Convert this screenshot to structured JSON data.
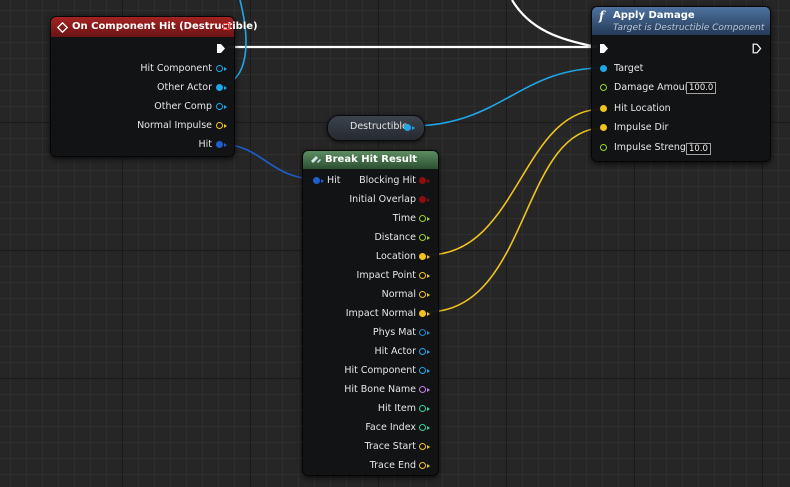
{
  "colors": {
    "event_header": "#8d1b1b",
    "function_header": "#3c5b83",
    "pure_header": "#3e6a44",
    "exec": "#ffffff",
    "object": "#1fa7ea",
    "struct_hit": "#1e5fcc",
    "vector": "#f0c41e",
    "float": "#9ad42c",
    "bool": "#8b0f0f",
    "name": "#c77cf0",
    "int": "#2fd3a0",
    "phys": "#1e8ec7"
  },
  "event_node": {
    "title": "On Component Hit (Destructible)",
    "icon": "event-diamond-icon",
    "outputs": [
      {
        "label": "Hit Component"
      },
      {
        "label": "Other Actor"
      },
      {
        "label": "Other Comp"
      },
      {
        "label": "Normal Impulse"
      },
      {
        "label": "Hit"
      }
    ]
  },
  "variable_node": {
    "label": "Destructible"
  },
  "break_node": {
    "title": "Break Hit Result",
    "icon": "break-struct-icon",
    "input_label": "Hit",
    "outputs": [
      {
        "label": "Blocking Hit"
      },
      {
        "label": "Initial Overlap"
      },
      {
        "label": "Time"
      },
      {
        "label": "Distance"
      },
      {
        "label": "Location"
      },
      {
        "label": "Impact Point"
      },
      {
        "label": "Normal"
      },
      {
        "label": "Impact Normal"
      },
      {
        "label": "Phys Mat"
      },
      {
        "label": "Hit Actor"
      },
      {
        "label": "Hit Component"
      },
      {
        "label": "Hit Bone Name"
      },
      {
        "label": "Hit Item"
      },
      {
        "label": "Face Index"
      },
      {
        "label": "Trace Start"
      },
      {
        "label": "Trace End"
      }
    ]
  },
  "apply_node": {
    "title": "Apply Damage",
    "subtitle": "Target is Destructible Component",
    "icon": "function-icon",
    "icon_glyph": "f",
    "inputs": [
      {
        "label": "Target"
      },
      {
        "label": "Damage Amount",
        "value": "100.0"
      },
      {
        "label": "Hit Location"
      },
      {
        "label": "Impulse Dir"
      },
      {
        "label": "Impulse Strength",
        "value": "10.0"
      }
    ]
  }
}
